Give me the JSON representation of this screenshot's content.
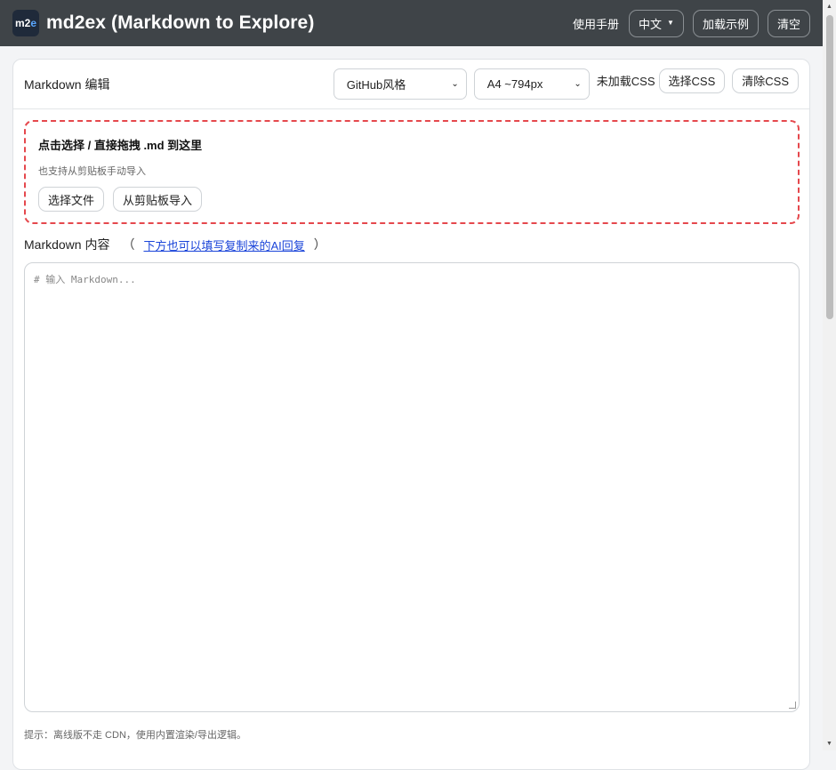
{
  "topbar": {
    "logo_text_1": "m2",
    "logo_text_2": "e",
    "title": "md2ex (Markdown to Explore)",
    "manual": "使用手册",
    "language": "中文",
    "load_example": "加载示例",
    "clear": "清空"
  },
  "editor_card": {
    "title": "Markdown 编辑",
    "style_select": "GitHub风格",
    "paper_select": "A4 ~794px",
    "css_status": "未加载CSS",
    "choose_css": "选择CSS",
    "clear_css": "清除CSS"
  },
  "dropzone": {
    "title": "点击选择 / 直接拖拽 .md 到这里",
    "subtitle": "也支持从剪贴板手动导入",
    "choose_file": "选择文件",
    "import_clipboard": "从剪贴板导入"
  },
  "content": {
    "label": "Markdown 内容",
    "paren_open": "（",
    "ai_link": "下方也可以填写复制来的AI回复",
    "paren_close": "）",
    "placeholder": "# 输入 Markdown..."
  },
  "hint": "提示：离线版不走 CDN，使用内置渲染/导出逻辑。",
  "icons": {
    "logo": "m2e-logo-icon",
    "caret": "caret-down-icon",
    "select_chevron": "chevron-down-icon"
  }
}
